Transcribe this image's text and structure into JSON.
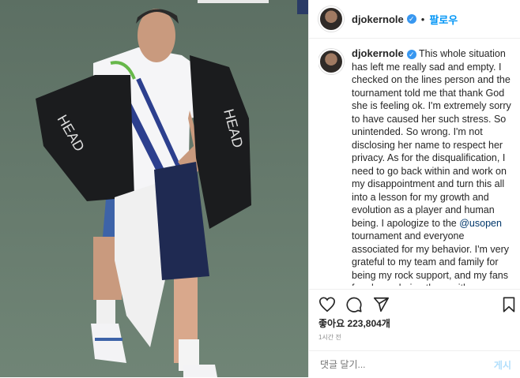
{
  "post": {
    "username": "djokernole",
    "follow_label": "팔로우",
    "caption_text": "This whole situation has left me really sad and empty. I checked on the lines person and the tournament told me that thank God she is feeling ok. I'm extremely sorry to have caused her such stress. So unintended. So wrong. I'm not disclosing her name to respect her privacy. As for the disqualification, I need to go back within and work on my disappointment and turn this all into a lesson for my growth and evolution as a player and human being. I apologize to the",
    "mention": "@usopen",
    "caption_text_after": "tournament and everyone associated for my behavior. I'm very grateful to my team and family for being my rock support, and my fans for always being there with me. Thank you and I'm so sorry.",
    "likes_label": "좋아요 223,804개",
    "time_ago": "1시간 전",
    "comment_placeholder": "댓글 달기...",
    "post_button": "게시"
  },
  "icons": [
    "heart-icon",
    "comment-icon",
    "share-icon",
    "bookmark-icon",
    "verified-icon"
  ],
  "colors": {
    "link": "#0095f6",
    "verified": "#3897f0",
    "mention": "#00376b"
  }
}
